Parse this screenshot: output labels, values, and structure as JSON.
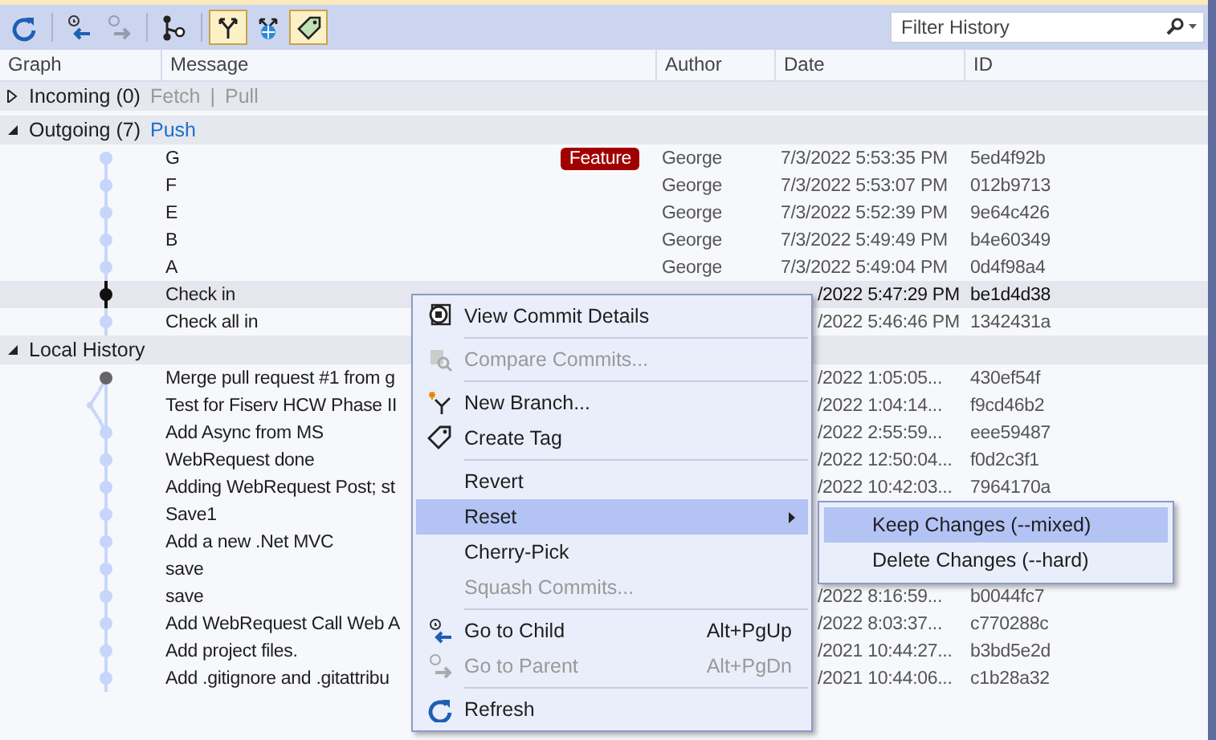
{
  "toolbar": {
    "buttons": [
      {
        "kind": "refresh",
        "disabled": false,
        "pressed": false
      },
      {
        "kind": "go-child",
        "disabled": false,
        "pressed": false
      },
      {
        "kind": "go-parent",
        "disabled": true,
        "pressed": false
      },
      {
        "kind": "graph",
        "disabled": false,
        "pressed": false
      },
      {
        "kind": "branches",
        "disabled": false,
        "pressed": true
      },
      {
        "kind": "remote",
        "disabled": false,
        "pressed": false
      },
      {
        "kind": "tags",
        "disabled": false,
        "pressed": true
      }
    ],
    "filter": {
      "placeholder": "Filter History"
    }
  },
  "columns": [
    "Graph",
    "Message",
    "Author",
    "Date",
    "ID"
  ],
  "incoming": {
    "title": "Incoming (0)",
    "expanded": false,
    "separator": "|",
    "links": [
      {
        "label": "Fetch",
        "disabled": true
      },
      {
        "label": "Pull",
        "disabled": true
      }
    ]
  },
  "outgoing": {
    "title": "Outgoing (7)",
    "expanded": true,
    "links": [
      {
        "label": "Push",
        "disabled": false
      }
    ],
    "rows": [
      {
        "kind": "commit",
        "message": "G",
        "badge": "Feature",
        "author": "George",
        "date": "7/3/2022 5:53:35 PM",
        "id": "5ed4f92b",
        "selected": false
      },
      {
        "kind": "commit",
        "message": "F",
        "author": "George",
        "date": "7/3/2022 5:53:07 PM",
        "id": "012b9713",
        "selected": false
      },
      {
        "kind": "commit",
        "message": "E",
        "author": "George",
        "date": "7/3/2022 5:52:39 PM",
        "id": "9e64c426",
        "selected": false
      },
      {
        "kind": "commit",
        "message": "B",
        "author": "George",
        "date": "7/3/2022 5:49:49 PM",
        "id": "b4e60349",
        "selected": false
      },
      {
        "kind": "commit",
        "message": "A",
        "author": "George",
        "date": "7/3/2022 5:49:04 PM",
        "id": "0d4f98a4",
        "selected": false
      },
      {
        "kind": "commit",
        "message": "Check in",
        "date": "/2022 5:47:29 PM",
        "id": "be1d4d38",
        "selected": true
      },
      {
        "kind": "commit",
        "message": "Check all in",
        "date": "/2022 5:46:46 PM",
        "id": "1342431a",
        "selected": false
      }
    ]
  },
  "local": {
    "title": "Local History",
    "expanded": true,
    "rows": [
      {
        "kind": "merge",
        "message": "Merge pull request #1 from g",
        "date": "/2022 1:05:05...",
        "id": "430ef54f",
        "selected": false
      },
      {
        "kind": "side",
        "message": "Test for Fiserv HCW Phase II",
        "date": "/2022 1:04:14...",
        "id": "f9cd46b2",
        "selected": false
      },
      {
        "kind": "join",
        "message": "Add Async from MS",
        "date": "/2022 2:55:59...",
        "id": "eee59487",
        "selected": false
      },
      {
        "kind": "commit",
        "message": "WebRequest done",
        "date": "/2022 12:50:04...",
        "id": "f0d2c3f1",
        "selected": false
      },
      {
        "kind": "commit",
        "message": "Adding WebRequest Post; st",
        "date": "/2022 10:42:03...",
        "id": "7964170a",
        "selected": false
      },
      {
        "kind": "commit",
        "message": "Save1",
        "selected": false
      },
      {
        "kind": "commit",
        "message": "Add a new .Net MVC",
        "selected": false
      },
      {
        "kind": "commit",
        "message": "save",
        "selected": false
      },
      {
        "kind": "commit",
        "message": "save",
        "date": "/2022 8:16:59...",
        "id": "b0044fc7",
        "selected": false
      },
      {
        "kind": "commit",
        "message": "Add WebRequest Call Web A",
        "date": "/2022 8:03:37...",
        "id": "c770288c",
        "selected": false
      },
      {
        "kind": "commit",
        "message": "Add project files.",
        "date": "/2021 10:44:27...",
        "id": "b3bd5e2d",
        "selected": false
      },
      {
        "kind": "commit",
        "message": "Add .gitignore and .gitattribu",
        "date": "/2021 10:44:06...",
        "id": "c1b28a32",
        "selected": false
      }
    ]
  },
  "context_menu": {
    "items": [
      {
        "kind": "details",
        "label": "View Commit Details",
        "disabled": false,
        "selected": false
      },
      {
        "kind": "separator"
      },
      {
        "kind": "compare",
        "label": "Compare Commits...",
        "disabled": true,
        "selected": false
      },
      {
        "kind": "separator"
      },
      {
        "kind": "branch",
        "label": "New Branch...",
        "disabled": false,
        "selected": false
      },
      {
        "kind": "tag",
        "label": "Create Tag",
        "disabled": false,
        "selected": false
      },
      {
        "kind": "separator"
      },
      {
        "kind": "plain",
        "label": "Revert",
        "disabled": false,
        "selected": false
      },
      {
        "kind": "submenu",
        "label": "Reset",
        "disabled": false,
        "selected": true
      },
      {
        "kind": "plain",
        "label": "Cherry-Pick",
        "disabled": false,
        "selected": false
      },
      {
        "kind": "plain",
        "label": "Squash Commits...",
        "disabled": true,
        "selected": false
      },
      {
        "kind": "separator"
      },
      {
        "kind": "child",
        "label": "Go to Child",
        "shortcut": "Alt+PgUp",
        "disabled": false,
        "selected": false
      },
      {
        "kind": "parent",
        "label": "Go to Parent",
        "shortcut": "Alt+PgDn",
        "disabled": true,
        "selected": false
      },
      {
        "kind": "separator"
      },
      {
        "kind": "refresh",
        "label": "Refresh",
        "disabled": false,
        "selected": false
      }
    ]
  },
  "submenu": {
    "items": [
      {
        "label": "Keep Changes (--mixed)",
        "selected": true
      },
      {
        "label": "Delete Changes (--hard)",
        "selected": false
      }
    ]
  }
}
